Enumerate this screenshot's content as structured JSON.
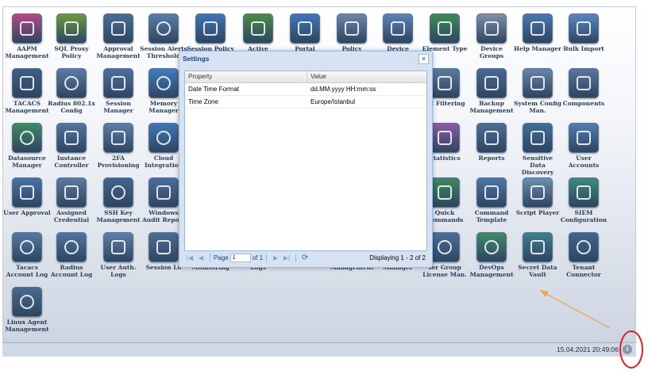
{
  "tiles": [
    {
      "label": "AAPM Management",
      "color": "#b34a87"
    },
    {
      "label": "SQL Proxy Policy",
      "color": "#6a9a3f"
    },
    {
      "label": "Approval Management",
      "color": "#4a6d95"
    },
    {
      "label": "Session Alerts Threshold",
      "color": "#5a7ea6"
    },
    {
      "label": "Session Policy",
      "color": "#3f74b3"
    },
    {
      "label": "Active",
      "color": "#4c8a4a"
    },
    {
      "label": "Portal",
      "color": "#3e77b8"
    },
    {
      "label": "Policy",
      "color": "#6b86a8"
    },
    {
      "label": "Device",
      "color": "#5b84b5"
    },
    {
      "label": "Element Type",
      "color": "#3f8a5a"
    },
    {
      "label": "Device Groups",
      "color": "#7e8fa6"
    },
    {
      "label": "Help Manager",
      "color": "#4a77b0"
    },
    {
      "label": "Bulk Import",
      "color": "#5b86c0"
    },
    {
      "label": "TACACS Management",
      "color": "#3e5f84"
    },
    {
      "label": "Radius 802.1x Config",
      "color": "#5a7ca5"
    },
    {
      "label": "Session Manager",
      "color": "#4e70a0"
    },
    {
      "label": "Memory Manager",
      "color": "#3f7fbf"
    },
    {
      "label": "AC Filtering",
      "color": "#5b7a9d"
    },
    {
      "label": "Backup Management",
      "color": "#4a6a92"
    },
    {
      "label": "System Config Man.",
      "color": "#6785aa"
    },
    {
      "label": "Components",
      "color": "#5975a0"
    },
    {
      "label": "Datasource Manager",
      "color": "#3d8a66"
    },
    {
      "label": "Instance Controller",
      "color": "#50759f"
    },
    {
      "label": "2FA Provisioning",
      "color": "#5a7fa8"
    },
    {
      "label": "Cloud Integration",
      "color": "#3f76b6"
    },
    {
      "label": "Statistics",
      "color": "#8d5aa8"
    },
    {
      "label": "Reports",
      "color": "#4d6e96"
    },
    {
      "label": "Sensitive Data Discovery",
      "color": "#3e6f9a"
    },
    {
      "label": "User Accounts",
      "color": "#4f7db3"
    },
    {
      "label": "User Approval",
      "color": "#4a72a6"
    },
    {
      "label": "Assigned Credential",
      "color": "#5a7aa0"
    },
    {
      "label": "SSH Key Management",
      "color": "#3f6690"
    },
    {
      "label": "Windows Audit Report",
      "color": "#4a6f9c"
    },
    {
      "label": "Quick Commands",
      "color": "#3d8a5a"
    },
    {
      "label": "Command Template",
      "color": "#4c76a8"
    },
    {
      "label": "Script Player",
      "color": "#6b8fb0"
    },
    {
      "label": "SIEM Configuration",
      "color": "#3f8a7a"
    },
    {
      "label": "Tacacs Account Log",
      "color": "#5478a3"
    },
    {
      "label": "Radius Account Log",
      "color": "#4e74a2"
    },
    {
      "label": "User Auth. Logs",
      "color": "#5a80ab"
    },
    {
      "label": "Session Lo",
      "color": "#4a6e98"
    },
    {
      "label": "Monitoring",
      "color": "#4d72a0"
    },
    {
      "label": "Logs",
      "color": "#5a7aa2"
    },
    {
      "label": "Management",
      "color": "#4b6f9a"
    },
    {
      "label": "Manager",
      "color": "#557aa4"
    },
    {
      "label": "ser Group License Man.",
      "color": "#4b6e98"
    },
    {
      "label": "DevOps Management",
      "color": "#3f8a6a"
    },
    {
      "label": "Secret Data Vault",
      "color": "#3d7f8c"
    },
    {
      "label": "Tenant Connector",
      "color": "#3e6690"
    },
    {
      "label": "Linux Agent Management",
      "color": "#4a6a90"
    }
  ],
  "dialog": {
    "title": "Settings",
    "close_glyph": "×",
    "columns": [
      "Property",
      "Value"
    ],
    "rows": [
      {
        "property": "Date Time Format",
        "value": "dd.MM.yyyy HH:mm:ss"
      },
      {
        "property": "Time Zone",
        "value": "Europe/Istanbul"
      }
    ],
    "pager": {
      "page_label": "Page",
      "page_value": "1",
      "of_label": "of 1",
      "display_text": "Displaying 1 - 2 of 2",
      "first_glyph": "|◀",
      "prev_glyph": "◀",
      "next_glyph": "▶",
      "last_glyph": "▶|",
      "refresh_glyph": "⟳"
    }
  },
  "statusbar": {
    "datetime": "15.04.2021 20:49:06",
    "info_glyph": "i"
  }
}
